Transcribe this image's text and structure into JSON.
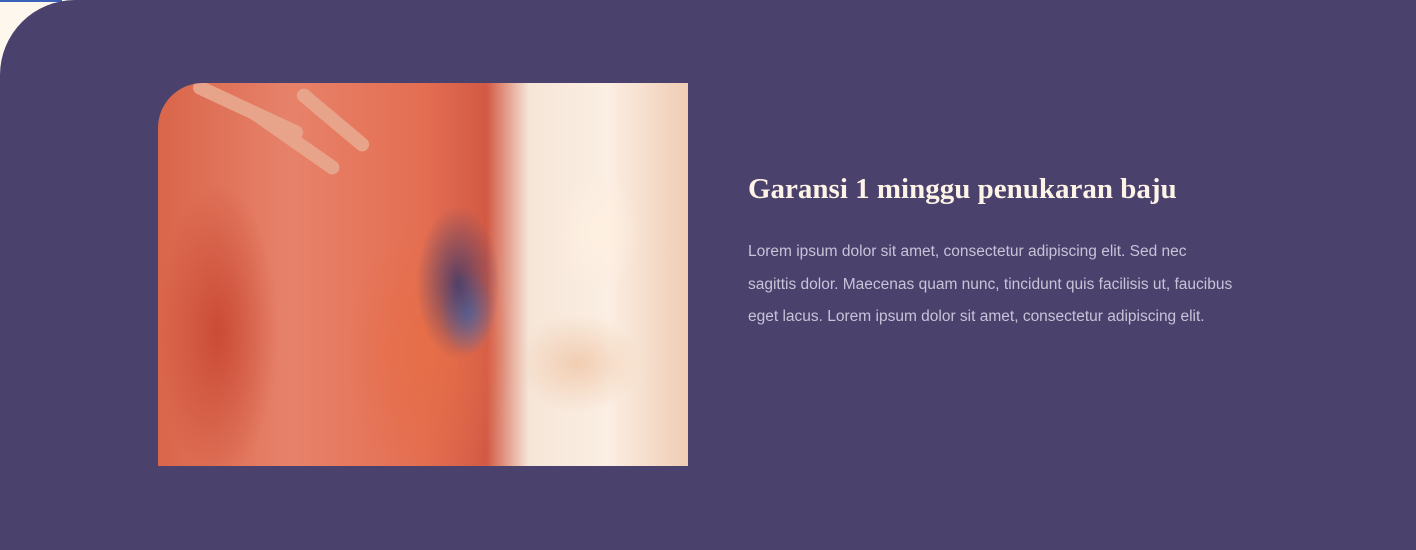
{
  "feature": {
    "title": "Garansi 1 minggu penukaran baju",
    "description": "Lorem ipsum dolor sit amet, consectetur adipiscing elit. Sed nec sagittis dolor. Maecenas quam nunc, tincidunt quis facilisis ut, faucibus eget lacus. Lorem ipsum dolor sit amet, consectetur adipiscing elit."
  },
  "colors": {
    "section_bg": "#4a416d",
    "page_bg": "#fdf7ee",
    "title": "#fdf3e6",
    "text": "#c9c3d8"
  }
}
